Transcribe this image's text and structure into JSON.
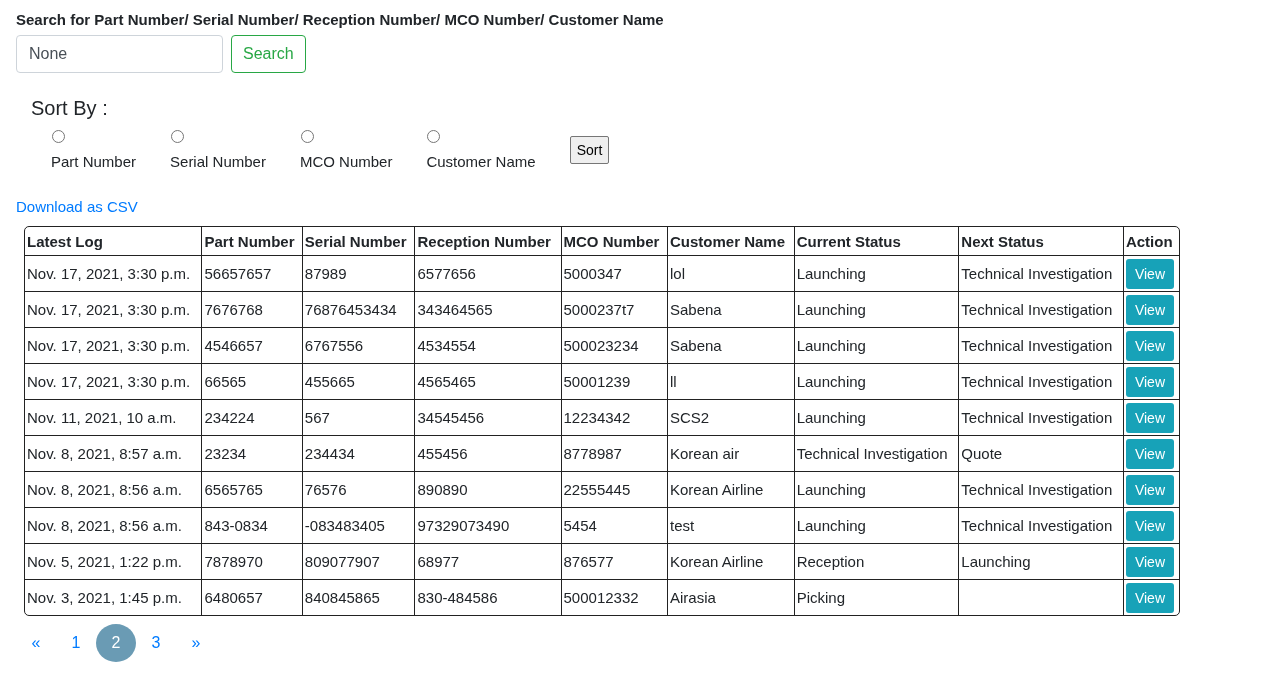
{
  "search": {
    "label": "Search for Part Number/ Serial Number/ Reception Number/ MCO Number/ Customer Name",
    "value": "None",
    "button": "Search"
  },
  "sort": {
    "title": "Sort By :",
    "options": [
      {
        "label": "Part Number",
        "selected": false
      },
      {
        "label": "Serial Number",
        "selected": false
      },
      {
        "label": "MCO Number",
        "selected": false
      },
      {
        "label": "Customer Name",
        "selected": false
      }
    ],
    "button": "Sort"
  },
  "download_link": "Download as CSV",
  "table": {
    "columns": [
      "Latest Log",
      "Part Number",
      "Serial Number",
      "Reception Number",
      "MCO Number",
      "Customer Name",
      "Current Status",
      "Next Status",
      "Action"
    ],
    "rows": [
      {
        "cells": [
          "Nov. 17, 2021, 3:30 p.m.",
          "56657657",
          "87989",
          "6577656",
          "5000347",
          "lol",
          "Launching",
          "Technical Investigation"
        ],
        "action": "View"
      },
      {
        "cells": [
          "Nov. 17, 2021, 3:30 p.m.",
          "7676768",
          "76876453434",
          "343464565",
          "5000237t7",
          "Sabena",
          "Launching",
          "Technical Investigation"
        ],
        "action": "View"
      },
      {
        "cells": [
          "Nov. 17, 2021, 3:30 p.m.",
          "4546657",
          "6767556",
          "4534554",
          "500023234",
          "Sabena",
          "Launching",
          "Technical Investigation"
        ],
        "action": "View"
      },
      {
        "cells": [
          "Nov. 17, 2021, 3:30 p.m.",
          "66565",
          "455665",
          "4565465",
          "50001239",
          "ll",
          "Launching",
          "Technical Investigation"
        ],
        "action": "View"
      },
      {
        "cells": [
          "Nov. 11, 2021, 10 a.m.",
          "234224",
          "567",
          "34545456",
          "12234342",
          "SCS2",
          "Launching",
          "Technical Investigation"
        ],
        "action": "View"
      },
      {
        "cells": [
          "Nov. 8, 2021, 8:57 a.m.",
          "23234",
          "234434",
          "455456",
          "8778987",
          "Korean air",
          "Technical Investigation",
          "Quote"
        ],
        "action": "View"
      },
      {
        "cells": [
          "Nov. 8, 2021, 8:56 a.m.",
          "6565765",
          "76576",
          "890890",
          "22555445",
          "Korean Airline",
          "Launching",
          "Technical Investigation"
        ],
        "action": "View"
      },
      {
        "cells": [
          "Nov. 8, 2021, 8:56 a.m.",
          "843-0834",
          "-083483405",
          "97329073490",
          "5454",
          "test",
          "Launching",
          "Technical Investigation"
        ],
        "action": "View"
      },
      {
        "cells": [
          "Nov. 5, 2021, 1:22 p.m.",
          "7878970",
          "809077907",
          "68977",
          "876577",
          "Korean Airline",
          "Reception",
          "Launching"
        ],
        "action": "View"
      },
      {
        "cells": [
          "Nov. 3, 2021, 1:45 p.m.",
          "6480657",
          "840845865",
          "830-484586",
          "500012332",
          "Airasia",
          "Picking",
          null
        ],
        "action": "View"
      }
    ]
  },
  "pagination": [
    {
      "label": "«",
      "selected": false
    },
    {
      "label": "1",
      "selected": false
    },
    {
      "label": "2",
      "selected": true
    },
    {
      "label": "3",
      "selected": false
    },
    {
      "label": "»",
      "selected": false
    }
  ]
}
